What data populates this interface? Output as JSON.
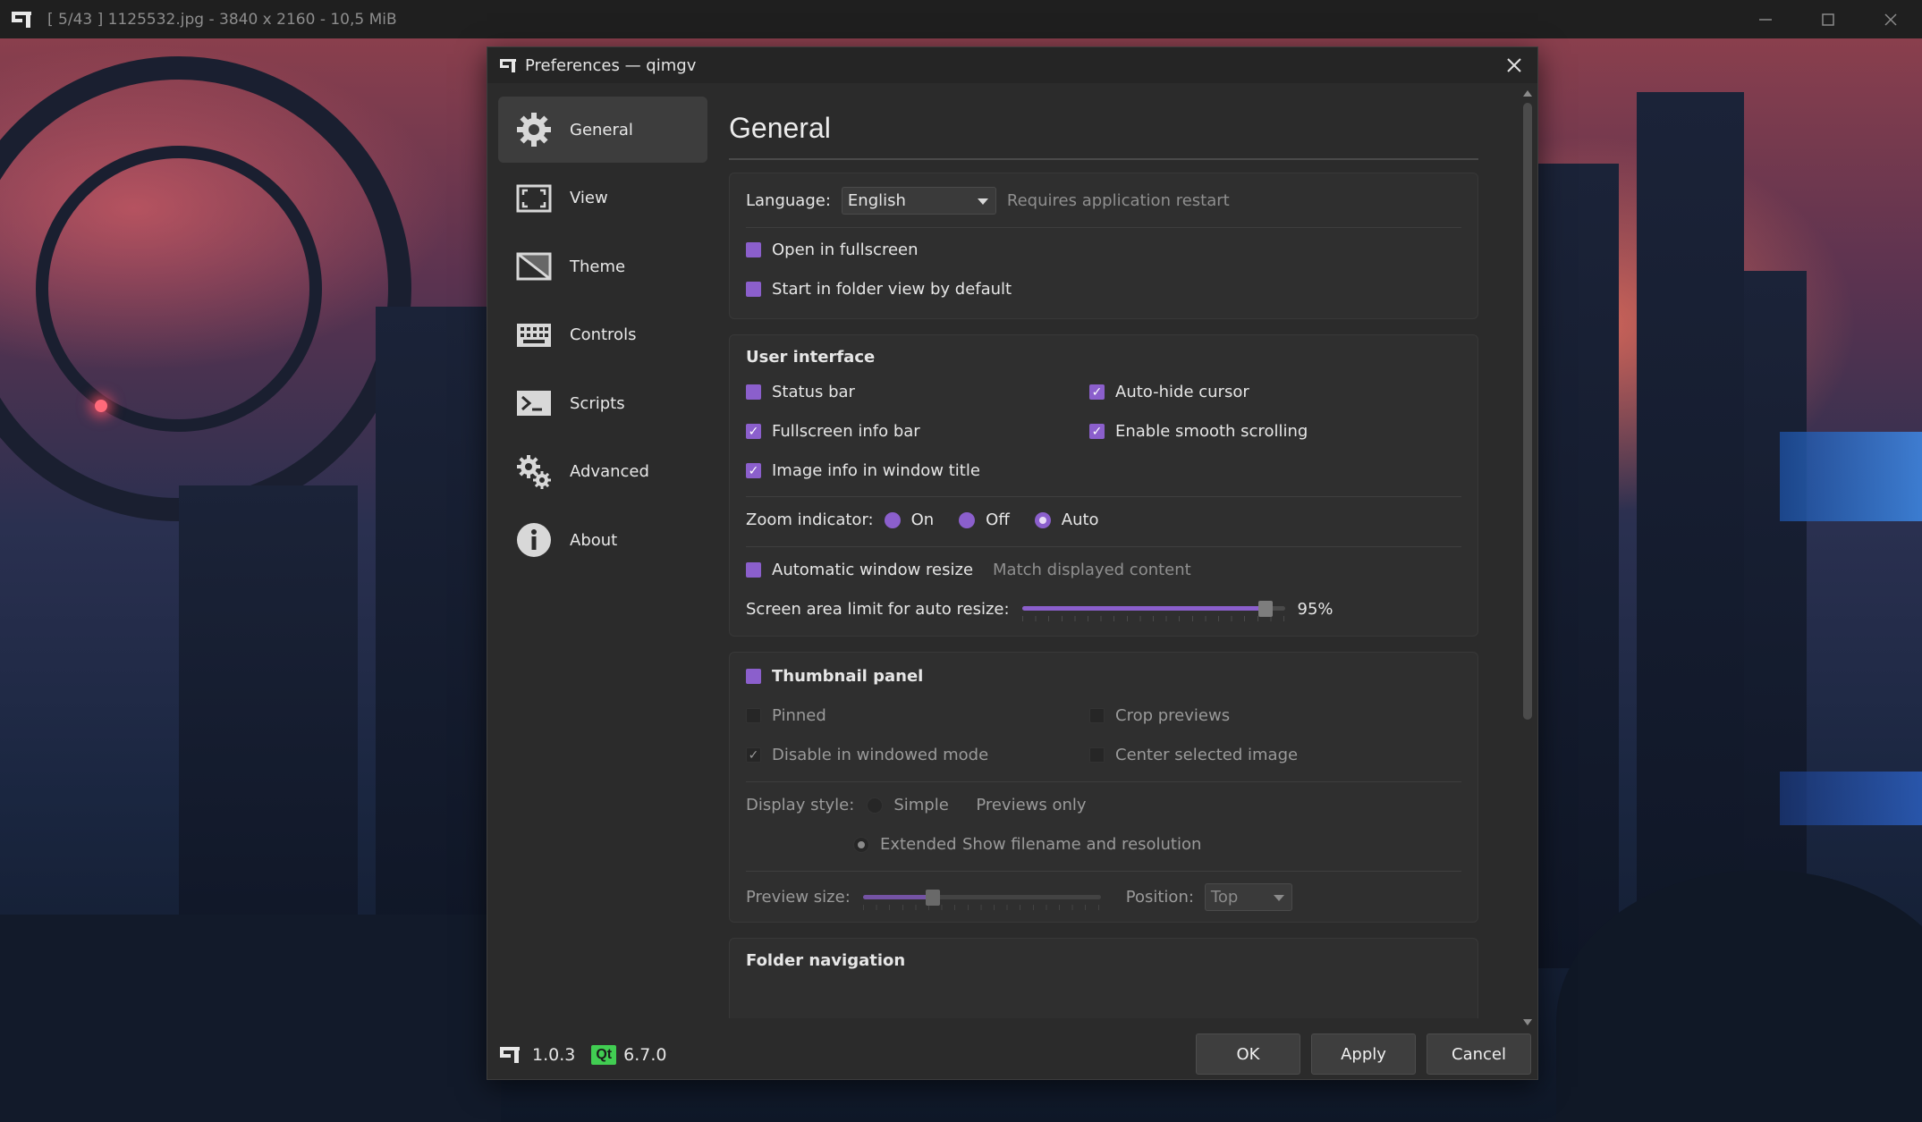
{
  "app": {
    "title": "[ 5/43 ]  1125532.jpg  -  3840 x 2160  -  10,5 MiB"
  },
  "dialog": {
    "title": "Preferences — qimgv",
    "close_label": "✕"
  },
  "sidebar": {
    "items": [
      {
        "label": "General",
        "icon": "gear-icon",
        "active": true
      },
      {
        "label": "View",
        "icon": "fullscreen-icon"
      },
      {
        "label": "Theme",
        "icon": "theme-icon"
      },
      {
        "label": "Controls",
        "icon": "keyboard-icon"
      },
      {
        "label": "Scripts",
        "icon": "terminal-icon"
      },
      {
        "label": "Advanced",
        "icon": "gears-icon"
      },
      {
        "label": "About",
        "icon": "info-icon"
      }
    ]
  },
  "footer": {
    "app_version": "1.0.3",
    "qt_badge": "Qt",
    "qt_version": "6.7.0"
  },
  "page": {
    "title": "General"
  },
  "general": {
    "language_label": "Language:",
    "language_value": "English",
    "language_hint": "Requires application restart",
    "open_fullscreen": "Open in fullscreen",
    "folder_view_default": "Start in folder view by default"
  },
  "ui": {
    "heading": "User interface",
    "status_bar": "Status bar",
    "auto_hide_cursor": "Auto-hide cursor",
    "fullscreen_info_bar": "Fullscreen info bar",
    "smooth_scrolling": "Enable smooth scrolling",
    "image_info_title": "Image info in window title",
    "zoom_label": "Zoom indicator:",
    "zoom_on": "On",
    "zoom_off": "Off",
    "zoom_auto": "Auto",
    "zoom_selected": "Auto",
    "auto_resize": "Automatic window resize",
    "auto_resize_hint": "Match displayed content",
    "screen_limit_label": "Screen area limit for auto resize:",
    "screen_limit_value": "95%",
    "screen_limit_fraction": 0.95
  },
  "thumbs": {
    "heading": "Thumbnail panel",
    "pinned": "Pinned",
    "crop_previews": "Crop previews",
    "disable_windowed": "Disable in windowed mode",
    "center_selected": "Center selected image",
    "display_style_label": "Display style:",
    "style_simple": "Simple",
    "style_simple_hint": "Previews only",
    "style_extended": "Extended",
    "style_extended_hint": "Show filename and resolution",
    "preview_size_label": "Preview size:",
    "preview_size_fraction": 0.28,
    "position_label": "Position:",
    "position_value": "Top"
  },
  "folder": {
    "heading": "Folder navigation"
  },
  "buttons": {
    "ok": "OK",
    "apply": "Apply",
    "cancel": "Cancel"
  },
  "colors": {
    "accent": "#8b5fcc",
    "dialog_bg": "#2b2b2b",
    "qt_green": "#41cd52"
  }
}
